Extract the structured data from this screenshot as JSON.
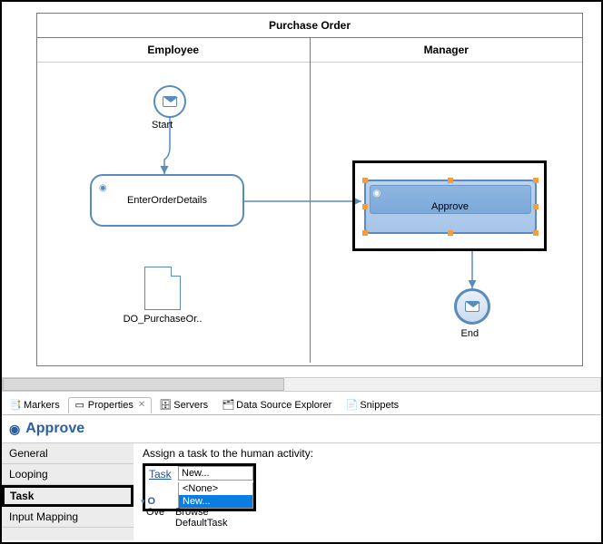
{
  "pool": {
    "title": "Purchase Order",
    "lanes": [
      {
        "title": "Employee"
      },
      {
        "title": "Manager"
      }
    ]
  },
  "nodes": {
    "start": {
      "label": "Start"
    },
    "enterOrder": {
      "label": "EnterOrderDetails"
    },
    "approve": {
      "label": "Approve"
    },
    "dataObject": {
      "label": "DO_PurchaseOr.."
    },
    "end": {
      "label": "End"
    }
  },
  "tabs": {
    "markers": "Markers",
    "properties": "Properties",
    "servers": "Servers",
    "dataSourceExplorer": "Data Source Explorer",
    "snippets": "Snippets"
  },
  "properties": {
    "title": "Approve",
    "sidebar": {
      "general": "General",
      "looping": "Looping",
      "task": "Task",
      "inputMapping": "Input Mapping"
    },
    "content": {
      "assignLabel": "Assign a task to the human activity:",
      "taskLinkLabel": "Task",
      "dropdownValue": "New...",
      "options": {
        "none": "<None>",
        "new": "New...",
        "browse": "Browse",
        "defaultTask": "DefaultTask"
      },
      "overviewLabel": "Overview",
      "overviewShort": "Ove"
    }
  }
}
